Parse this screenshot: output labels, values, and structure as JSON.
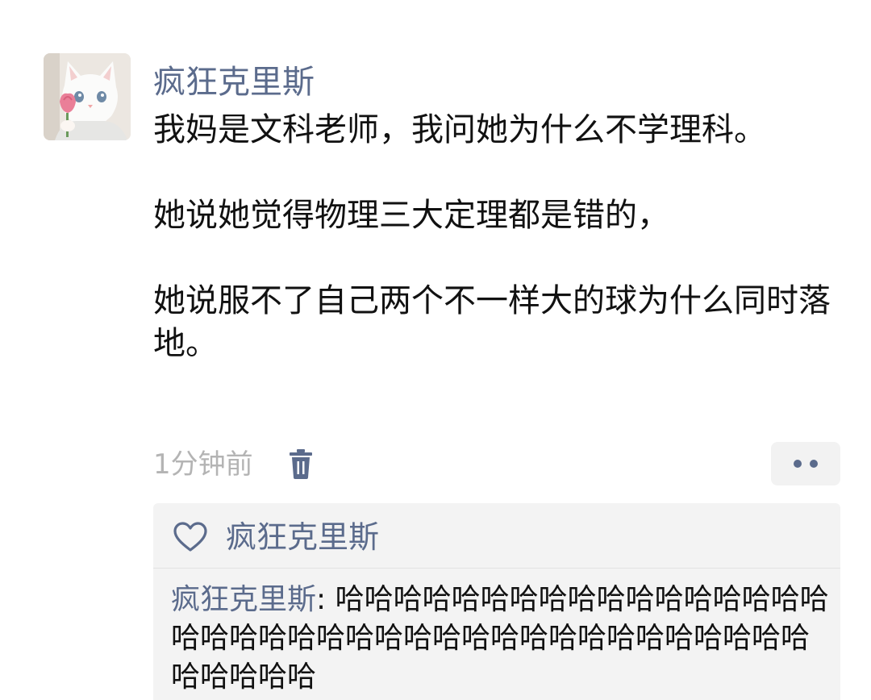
{
  "post": {
    "author": "疯狂克里斯",
    "paragraphs": [
      "我妈是文科老师，我问她为什么不学理科。",
      "她说她觉得物理三大定理都是错的，",
      "她说服不了自己两个不一样大的球为什么同时落地。"
    ],
    "time": "1分钟前"
  },
  "icons": {
    "delete": "trash-icon",
    "more": "more-dots-icon",
    "like": "heart-icon"
  },
  "likes": {
    "names": "疯狂克里斯"
  },
  "comment": {
    "author": "疯狂克里斯",
    "separator": ": ",
    "text": "哈哈哈哈哈哈哈哈哈哈哈哈哈哈哈哈哈哈哈哈哈哈哈哈哈哈哈哈哈哈哈哈哈哈哈哈哈哈哈哈哈哈哈哈"
  },
  "colors": {
    "link": "#5b6b8c",
    "text": "#111111",
    "muted": "#b4b4b4",
    "panel": "#f3f3f3"
  }
}
